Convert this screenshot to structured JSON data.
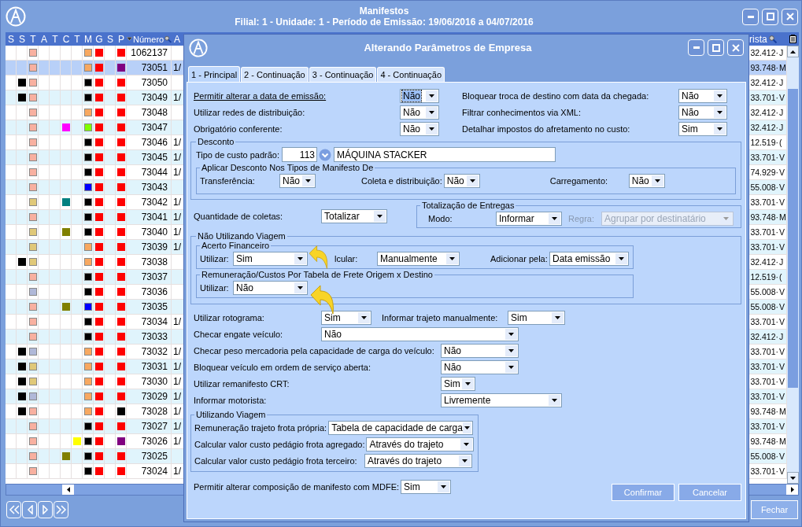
{
  "window": {
    "title": "Manifestos",
    "subtitle": "Filial: 1 - Unidade: 1 - Período de Emissão: 19/06/2016 a 04/07/2016"
  },
  "grid": {
    "columns": [
      "S",
      "S",
      "T",
      "A",
      "T",
      "C",
      "T",
      "M",
      "G",
      "S",
      "P"
    ],
    "number_header": "Número",
    "a_header": "A",
    "right_header": "rista",
    "rows": [
      {
        "number": "1062137",
        "r1": "32.412·",
        "r2": "J",
        "selected": false,
        "flags": {
          "t": {
            "color": "#f8b0a0"
          },
          "m": {
            "color": "#f8a860"
          },
          "g": {
            "color": "#ff0000"
          },
          "p": {
            "color": "#ff0000"
          }
        }
      },
      {
        "number": "73051",
        "a": "1/",
        "r1": "93.748·",
        "r2": "M",
        "selected": true,
        "flags": {
          "t": {
            "color": "#f8b0a0"
          },
          "m": {
            "color": "#f8a860"
          },
          "g": {
            "color": "#ff0000"
          },
          "p": {
            "color": "#800080"
          }
        }
      },
      {
        "number": "73050",
        "r1": "32.412·",
        "r2": "J",
        "selected": false,
        "flags": {
          "s_2": {
            "color": "#000000"
          },
          "t": {
            "color": "#f8b0a0"
          },
          "m": {
            "color": "#000000"
          },
          "g": {
            "color": "#ff0000"
          },
          "p": {
            "color": "#ff0000"
          }
        }
      },
      {
        "number": "73049",
        "a": "1/",
        "r1": "33.701·",
        "r2": "V",
        "selected": false,
        "flags": {
          "s_2": {
            "color": "#000000"
          },
          "t": {
            "color": "#f8b0a0"
          },
          "m": {
            "color": "#000000"
          },
          "g": {
            "color": "#ff0000"
          },
          "p": {
            "color": "#ff0000"
          }
        }
      },
      {
        "number": "73048",
        "r1": "32.412·",
        "r2": "J",
        "selected": false,
        "flags": {
          "t": {
            "color": "#f8b0a0"
          },
          "m": {
            "color": "#f8a860"
          },
          "g": {
            "color": "#ff0000"
          },
          "p": {
            "color": "#ff0000"
          }
        }
      },
      {
        "number": "73047",
        "r1": "32.412·",
        "r2": "J",
        "selected": false,
        "flags": {
          "t": {
            "color": "#f8b0a0"
          },
          "c": {
            "color": "#ff00ff"
          },
          "m": {
            "color": "#80ff00"
          },
          "g": {
            "color": "#ff0000"
          },
          "p": {
            "color": "#ff0000"
          }
        }
      },
      {
        "number": "73046",
        "a": "1/",
        "r1": "12.519·",
        "r2": "(",
        "selected": false,
        "flags": {
          "t": {
            "color": "#f8b0a0"
          },
          "m": {
            "color": "#000000"
          },
          "g": {
            "color": "#ff0000"
          },
          "p": {
            "color": "#ff0000"
          }
        }
      },
      {
        "number": "73045",
        "a": "1/",
        "r1": "33.701·",
        "r2": "V",
        "selected": false,
        "flags": {
          "t": {
            "color": "#f8b0a0"
          },
          "m": {
            "color": "#000000"
          },
          "g": {
            "color": "#ff0000"
          },
          "p": {
            "color": "#ff0000"
          }
        }
      },
      {
        "number": "73044",
        "a": "1/",
        "r1": "74.929·",
        "r2": "V",
        "selected": false,
        "flags": {
          "t": {
            "color": "#f8b0a0"
          },
          "m": {
            "color": "#000000"
          },
          "g": {
            "color": "#ff0000"
          },
          "p": {
            "color": "#ff0000"
          }
        }
      },
      {
        "number": "73043",
        "r1": "55.008·",
        "r2": "V",
        "selected": false,
        "flags": {
          "t": {
            "color": "#f8b0a0"
          },
          "m": {
            "color": "#0000ff"
          },
          "g": {
            "color": "#ff0000"
          },
          "p": {
            "color": "#ff0000"
          }
        }
      },
      {
        "number": "73042",
        "a": "1/",
        "r1": "33.701·",
        "r2": "V",
        "selected": false,
        "flags": {
          "t": {
            "color": "#e0c878"
          },
          "c": {
            "color": "#008080"
          },
          "m": {
            "color": "#000000"
          },
          "g": {
            "color": "#ff0000"
          },
          "p": {
            "color": "#ff0000"
          }
        }
      },
      {
        "number": "73041",
        "a": "1/",
        "r1": "93.748·",
        "r2": "M",
        "selected": false,
        "flags": {
          "t": {
            "color": "#f8b0a0"
          },
          "m": {
            "color": "#000000"
          },
          "g": {
            "color": "#ff0000"
          },
          "p": {
            "color": "#ff0000"
          }
        }
      },
      {
        "number": "73040",
        "a": "1/",
        "r1": "33.701·",
        "r2": "V",
        "selected": false,
        "flags": {
          "t": {
            "color": "#e0c878"
          },
          "c": {
            "color": "#808000"
          },
          "m": {
            "color": "#000000"
          },
          "g": {
            "color": "#ff0000"
          },
          "p": {
            "color": "#ff0000"
          }
        }
      },
      {
        "number": "73039",
        "a": "1/",
        "r1": "33.701·",
        "r2": "V",
        "selected": false,
        "flags": {
          "t": {
            "color": "#e0c878"
          },
          "m": {
            "color": "#f8a860"
          },
          "g": {
            "color": "#ff0000"
          },
          "p": {
            "color": "#ff0000"
          }
        }
      },
      {
        "number": "73038",
        "r1": "32.412·",
        "r2": "J",
        "selected": false,
        "flags": {
          "s_2": {
            "color": "#000000"
          },
          "t": {
            "color": "#e0c878"
          },
          "m": {
            "color": "#f8a860"
          },
          "g": {
            "color": "#ff0000"
          },
          "p": {
            "color": "#ff0000"
          }
        }
      },
      {
        "number": "73037",
        "r1": "12.519·",
        "r2": "(",
        "selected": false,
        "flags": {
          "t": {
            "color": "#f8b0a0"
          },
          "m": {
            "color": "#000000"
          },
          "g": {
            "color": "#ff0000"
          },
          "p": {
            "color": "#ff0000"
          }
        }
      },
      {
        "number": "73036",
        "r1": "55.008·",
        "r2": "V",
        "selected": false,
        "flags": {
          "t": {
            "color": "#b0b8d8"
          },
          "m": {
            "color": "#000000"
          },
          "g": {
            "color": "#ff0000"
          },
          "p": {
            "color": "#ff0000"
          }
        }
      },
      {
        "number": "73035",
        "r1": "55.008·",
        "r2": "V",
        "selected": false,
        "flags": {
          "t": {
            "color": "#f8b0a0"
          },
          "c": {
            "color": "#808000"
          },
          "m": {
            "color": "#0000ff"
          },
          "g": {
            "color": "#ff0000"
          },
          "p": {
            "color": "#ff0000"
          }
        }
      },
      {
        "number": "73034",
        "a": "1/",
        "r1": "33.701·",
        "r2": "V",
        "selected": false,
        "flags": {
          "t": {
            "color": "#f8b0a0"
          },
          "m": {
            "color": "#000000"
          },
          "g": {
            "color": "#ff0000"
          },
          "p": {
            "color": "#ff0000"
          }
        }
      },
      {
        "number": "73033",
        "r1": "32.412·",
        "r2": "J",
        "selected": false,
        "flags": {
          "t": {
            "color": "#f8b0a0"
          },
          "m": {
            "color": "#000000"
          },
          "g": {
            "color": "#ff0000"
          },
          "p": {
            "color": "#ff0000"
          }
        }
      },
      {
        "number": "73032",
        "a": "1/",
        "r1": "33.701·",
        "r2": "V",
        "selected": false,
        "flags": {
          "s_2": {
            "color": "#000000"
          },
          "t": {
            "color": "#b0b8d8"
          },
          "m": {
            "color": "#f8a860"
          },
          "g": {
            "color": "#ff0000"
          },
          "p": {
            "color": "#ff0000"
          }
        }
      },
      {
        "number": "73031",
        "a": "1/",
        "r1": "33.701·",
        "r2": "V",
        "selected": false,
        "flags": {
          "s_2": {
            "color": "#000000"
          },
          "t": {
            "color": "#e0c878"
          },
          "m": {
            "color": "#f8a860"
          },
          "g": {
            "color": "#ff0000"
          },
          "p": {
            "color": "#ff0000"
          }
        }
      },
      {
        "number": "73030",
        "a": "1/",
        "r1": "33.701·",
        "r2": "V",
        "selected": false,
        "flags": {
          "s_2": {
            "color": "#000000"
          },
          "t": {
            "color": "#e0c878"
          },
          "m": {
            "color": "#f8a860"
          },
          "g": {
            "color": "#ff0000"
          },
          "p": {
            "color": "#ff0000"
          }
        }
      },
      {
        "number": "73029",
        "a": "1/",
        "r1": "33.701·",
        "r2": "V",
        "selected": false,
        "flags": {
          "s_2": {
            "color": "#000000"
          },
          "t": {
            "color": "#b0b8d8"
          },
          "m": {
            "color": "#f8a860"
          },
          "g": {
            "color": "#ff0000"
          },
          "p": {
            "color": "#ff0000"
          }
        }
      },
      {
        "number": "73028",
        "a": "1/",
        "r1": "93.748·",
        "r2": "M",
        "selected": false,
        "flags": {
          "s_2": {
            "color": "#000000"
          },
          "t": {
            "color": "#f8b0a0"
          },
          "m": {
            "color": "#f8a860"
          },
          "g": {
            "color": "#ff0000"
          },
          "p": {
            "color": "#000000"
          }
        }
      },
      {
        "number": "73027",
        "a": "1/",
        "r1": "33.701·",
        "r2": "V",
        "selected": false,
        "flags": {
          "t": {
            "color": "#f8b0a0"
          },
          "m": {
            "color": "#000000"
          },
          "g": {
            "color": "#ff0000"
          },
          "p": {
            "color": "#ff0000"
          }
        }
      },
      {
        "number": "73026",
        "a": "1/",
        "r1": "93.748·",
        "r2": "M",
        "selected": false,
        "flags": {
          "t": {
            "color": "#f8b0a0"
          },
          "t_3": {
            "color": "#ffff00"
          },
          "m": {
            "color": "#000000"
          },
          "g": {
            "color": "#ff0000"
          },
          "p": {
            "color": "#800080"
          }
        }
      },
      {
        "number": "73025",
        "r1": "55.008·",
        "r2": "V",
        "selected": false,
        "flags": {
          "t": {
            "color": "#f8b0a0"
          },
          "c": {
            "color": "#808000"
          },
          "m": {
            "color": "#000000"
          },
          "g": {
            "color": "#ff0000"
          },
          "p": {
            "color": "#ff0000"
          }
        }
      },
      {
        "number": "73024",
        "a": "1/",
        "r1": "33.701·",
        "r2": "V",
        "selected": false,
        "flags": {
          "t": {
            "color": "#f8b0a0"
          },
          "m": {
            "color": "#000000"
          },
          "g": {
            "color": "#ff0000"
          },
          "p": {
            "color": "#ff0000"
          }
        }
      }
    ]
  },
  "footer": {
    "close_button": "Fechar"
  },
  "dialog": {
    "title": "Alterando Parâmetros de Empresa",
    "tabs": [
      {
        "label": "1 - Principal",
        "selected": true
      },
      {
        "label": "2 - Continuação",
        "selected": false
      },
      {
        "label": "3 - Continuação",
        "selected": false
      },
      {
        "label": "4 - Continuação",
        "selected": false
      }
    ],
    "top_left": [
      {
        "label": "Permitir alterar a data de emissão:",
        "value": "Não",
        "focused": true
      },
      {
        "label": "Utilizar redes de distribuição:",
        "value": "Não",
        "focused": false
      },
      {
        "label": "Obrigatório conferente:",
        "value": "Não",
        "focused": false
      }
    ],
    "top_right": [
      {
        "label": "Bloquear troca de destino com data da chegada:",
        "value": "Não"
      },
      {
        "label": "Filtrar conhecimentos via XML:",
        "value": "Não"
      },
      {
        "label": "Detalhar impostos do afretamento no custo:",
        "value": "Sim"
      }
    ],
    "desconto": {
      "title": "Desconto",
      "cost_type_label": "Tipo de custo padrão:",
      "cost_code": "113",
      "cost_name": "MÁQUINA STACKER",
      "apply_group": {
        "title": "Aplicar Desconto Nos Tipos de Manifesto De",
        "fields": [
          {
            "label": "Transferência:",
            "value": "Não"
          },
          {
            "label": "Coleta e distribuição:",
            "value": "Não"
          },
          {
            "label": "Carregamento:",
            "value": "Não"
          }
        ]
      }
    },
    "quantidade_coletas": {
      "label": "Quantidade de coletas:",
      "value": "Totalizar"
    },
    "totalizacao": {
      "title": "Totalização de Entregas",
      "fields": [
        {
          "label": "Modo:",
          "value": "Informar",
          "disabled": false
        },
        {
          "label": "Regra:",
          "value": "Agrupar por destinatário",
          "disabled": true
        }
      ]
    },
    "nao_utilizando_viagem": {
      "title": "Não Utilizando Viagem",
      "acerto": {
        "title": "Acerto Financeiro",
        "fields": [
          {
            "label": "Utilizar:",
            "value": "Sim"
          },
          {
            "label": "lcular:",
            "value": "Manualmente"
          },
          {
            "label": "Adicionar pela:",
            "value": "Data emissão"
          }
        ]
      },
      "remuneracao": {
        "title": "Remuneração/Custos Por Tabela de Frete Origem x Destino",
        "fields": [
          {
            "label": "Utilizar:",
            "value": "Não"
          }
        ]
      }
    },
    "rotograma": [
      {
        "label": "Utilizar rotograma:",
        "value": "Sim"
      },
      {
        "label": "Informar trajeto manualmente:",
        "value": "Sim"
      }
    ],
    "vehicle_fields": [
      {
        "label": "Checar engate veículo:",
        "value": "Não"
      },
      {
        "label": "Checar peso mercadoria pela capacidade de carga do veículo:",
        "value": "Não"
      },
      {
        "label": "Bloquear veículo em ordem de serviço aberta:",
        "value": "Não"
      },
      {
        "label": "Utilizar remanifesto CRT:",
        "value": "Sim"
      },
      {
        "label": "Informar motorista:",
        "value": "Livremente"
      }
    ],
    "utilizando_viagem": {
      "title": "Utilizando Viagem",
      "fields": [
        {
          "label": "Remuneração trajeto frota própria:",
          "value": "Tabela de capacidade de carga"
        },
        {
          "label": "Calcular valor custo pedágio frota agregado:",
          "value": "Através do trajeto"
        },
        {
          "label": "Calcular valor custo pedágio frota terceiro:",
          "value": "Através do trajeto"
        }
      ]
    },
    "mdfe": {
      "label": "Permitir alterar composição de manifesto com MDFE:",
      "value": "Sim"
    },
    "buttons": [
      "Confirmar",
      "Cancelar"
    ]
  }
}
